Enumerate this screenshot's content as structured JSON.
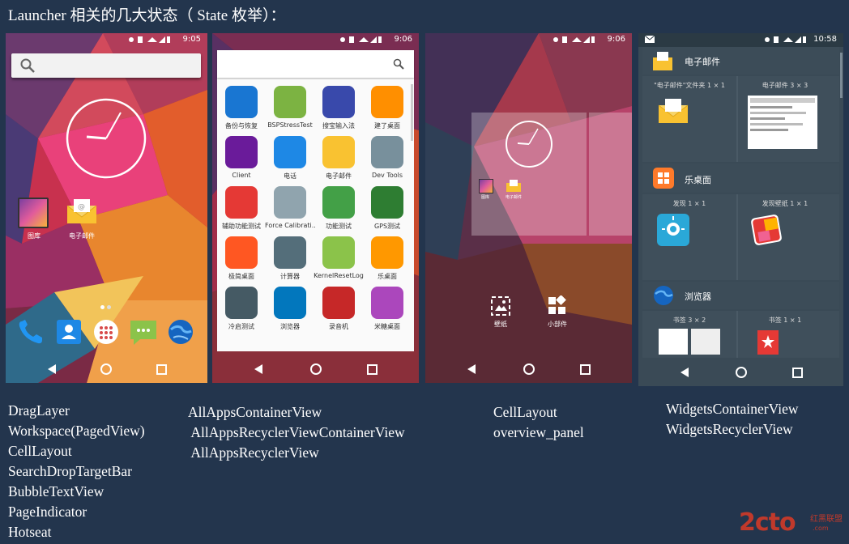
{
  "title": "Launcher 相关的几大状态（ State 枚举）：",
  "screens": [
    {
      "time": "9:05",
      "apps": [
        {
          "label": "图库"
        },
        {
          "label": "电子邮件"
        }
      ],
      "labels": "DragLayer\nWorkspace(PagedView)\nCellLayout\nSearchDropTargetBar\nBubbleTextView\nPageIndicator\nHotseat"
    },
    {
      "time": "9:06",
      "apps": [
        "备份与恢复",
        "BSPStressTest",
        "搜宝输入法",
        "建了桌面",
        "Client",
        "电话",
        "电子邮件",
        "Dev Tools",
        "辅助功能测试",
        "Force Calibrati...",
        "功能测试",
        "GPS测试",
        "极简桌面",
        "计算器",
        "KernelResetLog",
        "乐桌面",
        "冷启测试",
        "浏览器",
        "录音机",
        "米糖桌面"
      ],
      "labels": "AllAppsContainerView\n AllAppsRecyclerViewContainerView\n AllAppsRecyclerView"
    },
    {
      "time": "9:06",
      "mini": [
        "图库",
        "电子邮件"
      ],
      "tools": [
        {
          "label": "壁纸"
        },
        {
          "label": "小部件"
        }
      ],
      "labels": "CellLayout\noverview_panel"
    },
    {
      "time": "10:58",
      "sections": [
        {
          "name": "电子邮件",
          "items": [
            "\"电子邮件\"文件夹 1 × 1",
            "电子邮件 3 × 3"
          ]
        },
        {
          "name": "乐桌面",
          "items": [
            "发现 1 × 1",
            "发现壁纸 1 × 1"
          ]
        },
        {
          "name": "浏览器",
          "items": [
            "书签 3 × 2",
            "书签 1 × 1"
          ]
        }
      ],
      "labels": "WidgetsContainerView\nWidgetsRecyclerView"
    }
  ],
  "watermark": {
    "main": "2cto",
    "sub": "红黑联盟",
    "url": ".com"
  },
  "colors": {
    "background": "#23354d",
    "accent": "#ff5722"
  }
}
